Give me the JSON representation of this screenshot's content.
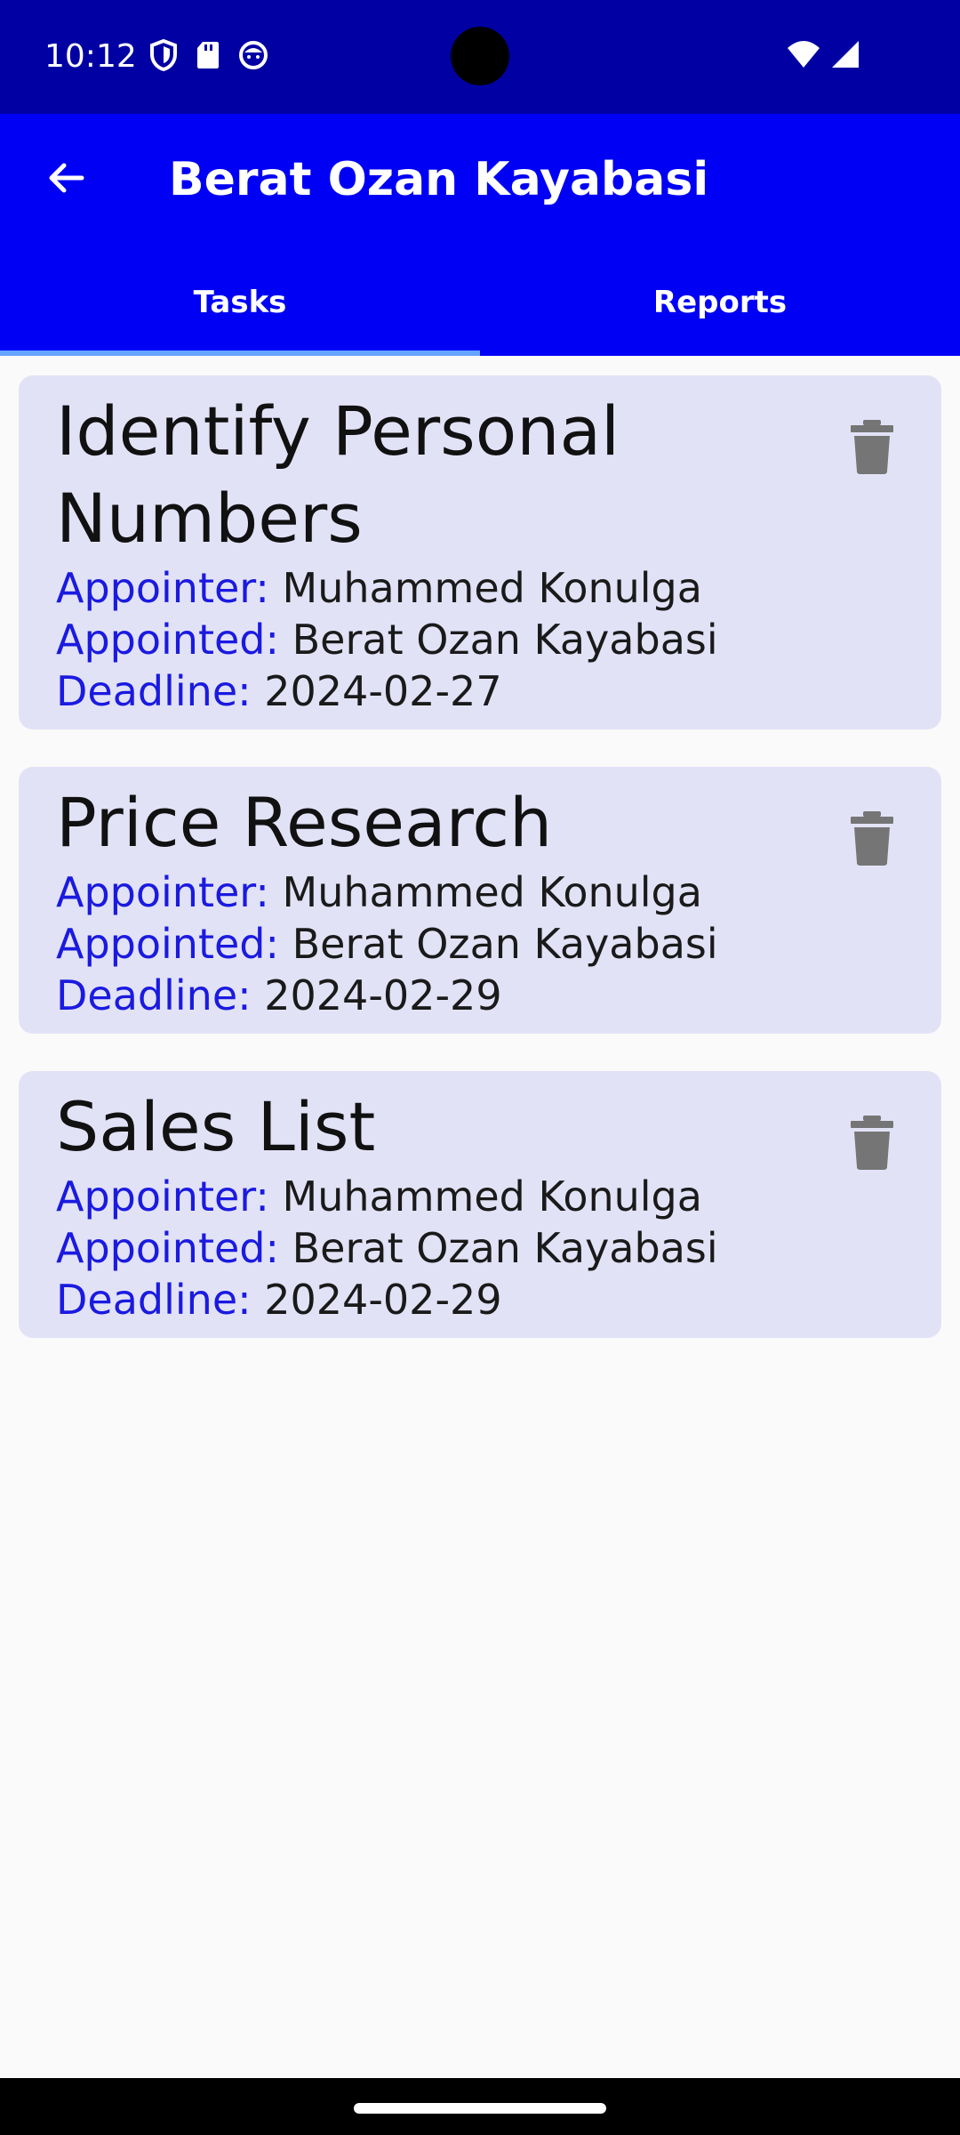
{
  "status_bar": {
    "time": "10:12",
    "left_icons": [
      "shield-icon",
      "sd-card-icon",
      "face-icon"
    ],
    "right_icons": [
      "wifi-icon",
      "cell-signal-icon"
    ],
    "background": "#0000a3"
  },
  "app_bar": {
    "title": "Berat Ozan Kayabasi",
    "back_icon": "arrow-back-icon",
    "background": "#0000f5"
  },
  "tabs": [
    {
      "label": "Tasks",
      "selected": true
    },
    {
      "label": "Reports",
      "selected": false
    }
  ],
  "tasks": [
    {
      "title": "Identify Personal Numbers",
      "appointer_label": "Appointer:",
      "appointer": "Muhammed Konulga",
      "appointed_label": "Appointed:",
      "appointed": "Berat Ozan Kayabasi",
      "deadline_label": "Deadline:",
      "deadline": "2024-02-27",
      "delete_icon": "trash-icon"
    },
    {
      "title": "Price Research",
      "appointer_label": "Appointer:",
      "appointer": "Muhammed Konulga",
      "appointed_label": "Appointed:",
      "appointed": "Berat Ozan Kayabasi",
      "deadline_label": "Deadline:",
      "deadline": "2024-02-29",
      "delete_icon": "trash-icon"
    },
    {
      "title": "Sales List",
      "appointer_label": "Appointer:",
      "appointer": "Muhammed Konulga",
      "appointed_label": "Appointed:",
      "appointed": "Berat Ozan Kayabasi",
      "deadline_label": "Deadline:",
      "deadline": "2024-02-29",
      "delete_icon": "trash-icon"
    }
  ],
  "colors": {
    "card_background": "#e2e2f7",
    "label_blue": "#1a1ae0",
    "tab_indicator": "#66a3ff",
    "page_background": "#fafafa"
  }
}
